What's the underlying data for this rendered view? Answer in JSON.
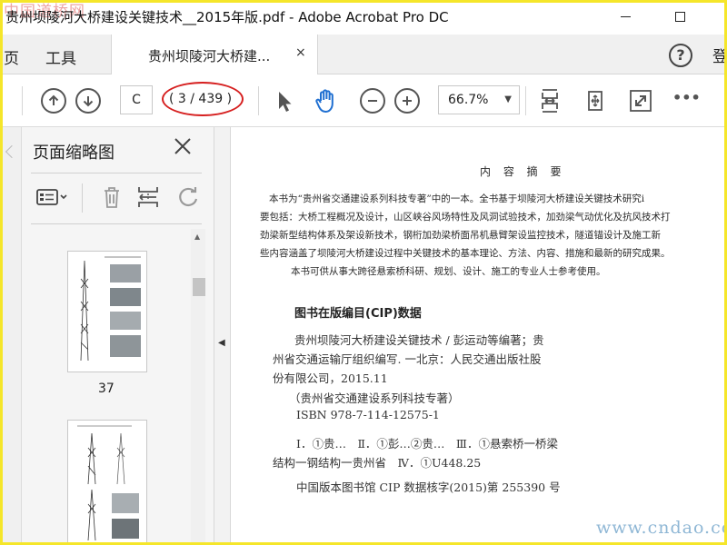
{
  "window": {
    "title": "贵州坝陵河大桥建设关键技术__2015年版.pdf - Adobe Acrobat Pro DC",
    "watermark_top": "中国道桥网"
  },
  "tabs": {
    "home_partial": "页",
    "tools": "工具",
    "document": "贵州坝陵河大桥建...",
    "close_glyph": "×",
    "help_glyph": "?",
    "login_partial": "登"
  },
  "toolbar": {
    "page_input": "C",
    "page_count": "( 3 / 439 )",
    "zoom": "66.7%",
    "more": "•••"
  },
  "sidebar": {
    "title": "页面缩略图",
    "thumb_page_label": "37"
  },
  "document": {
    "heading": "内 容 摘 要",
    "summary_lines": [
      "本书为“贵州省交通建设系列科技专著”中的一本。全书基于坝陵河大桥建设关键技术研究i",
      "要包括：大桥工程概况及设计，山区峡谷风场特性及风洞试验技术，加劲梁气动优化及抗风技术打",
      "劲梁新型结构体系及架设新技术，钢桁加劲梁桥面吊机悬臂架设监控技术，隧道锚设计及施工新",
      "些内容涵盖了坝陵河大桥建设过程中关键技术的基本理论、方法、内容、措施和最新的研究成果。",
      "本书可供从事大跨径悬索桥科研、规划、设计、施工的专业人士参考使用。"
    ],
    "cip_heading": "图书在版编目(CIP)数据",
    "cip_lines": [
      "贵州坝陵河大桥建设关键技术 / 彭运动等编著；贵",
      "州省交通运输厅组织编写. 一北京：人民交通出版社股",
      "份有限公司，2015.11",
      "（贵州省交通建设系列科技专著）",
      "ISBN 978-7-114-12575-1",
      "Ⅰ．①贵…　Ⅱ．①彭…②贵…　Ⅲ．①悬索桥一桥梁",
      "结构一钢结构一贵州省　Ⅳ．①U448.25",
      "中国版本图书馆 CIP 数据核字(2015)第 255390 号"
    ],
    "watermark_bottom": "www.cndao.com"
  }
}
